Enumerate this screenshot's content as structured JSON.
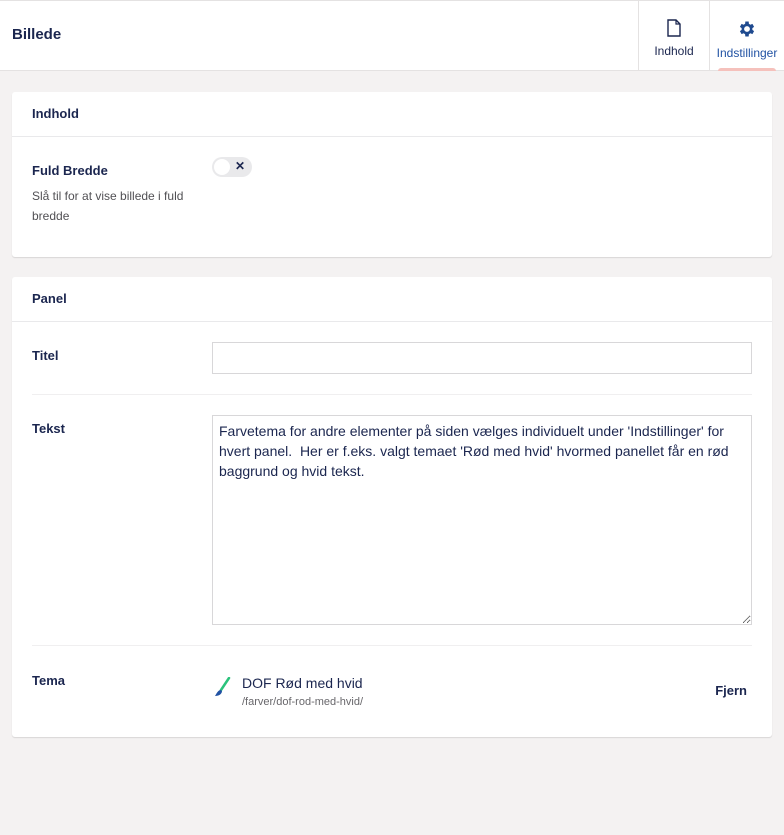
{
  "header": {
    "title": "Billede",
    "tabs": [
      {
        "label": "Indhold",
        "icon": "document-icon",
        "active": false
      },
      {
        "label": "Indstillinger",
        "icon": "gear-icon",
        "active": true
      }
    ]
  },
  "content_card": {
    "title": "Indhold",
    "full_width": {
      "label": "Fuld Bredde",
      "description": "Slå til for at vise billede i fuld bredde",
      "toggle_on": false,
      "toggle_symbol": "✕"
    }
  },
  "panel_card": {
    "title": "Panel",
    "title_field": {
      "label": "Titel",
      "value": ""
    },
    "text_field": {
      "label": "Tekst",
      "value": "Farvetema for andre elementer på siden vælges individuelt under 'Indstillinger' for hvert panel.  Her er f.eks. valgt temaet 'Rød med hvid' hvormed panellet får en rød baggrund og hvid tekst."
    },
    "theme": {
      "label": "Tema",
      "name": "DOF Rød med hvid",
      "path": "/farver/dof-rod-med-hvid/",
      "remove_label": "Fjern",
      "icon": "paintbrush-icon"
    }
  },
  "colors": {
    "text": "#1b264f",
    "accent": "#2152a3",
    "tab_underline": "#f5c1bc",
    "brush": "#2bc37c"
  }
}
